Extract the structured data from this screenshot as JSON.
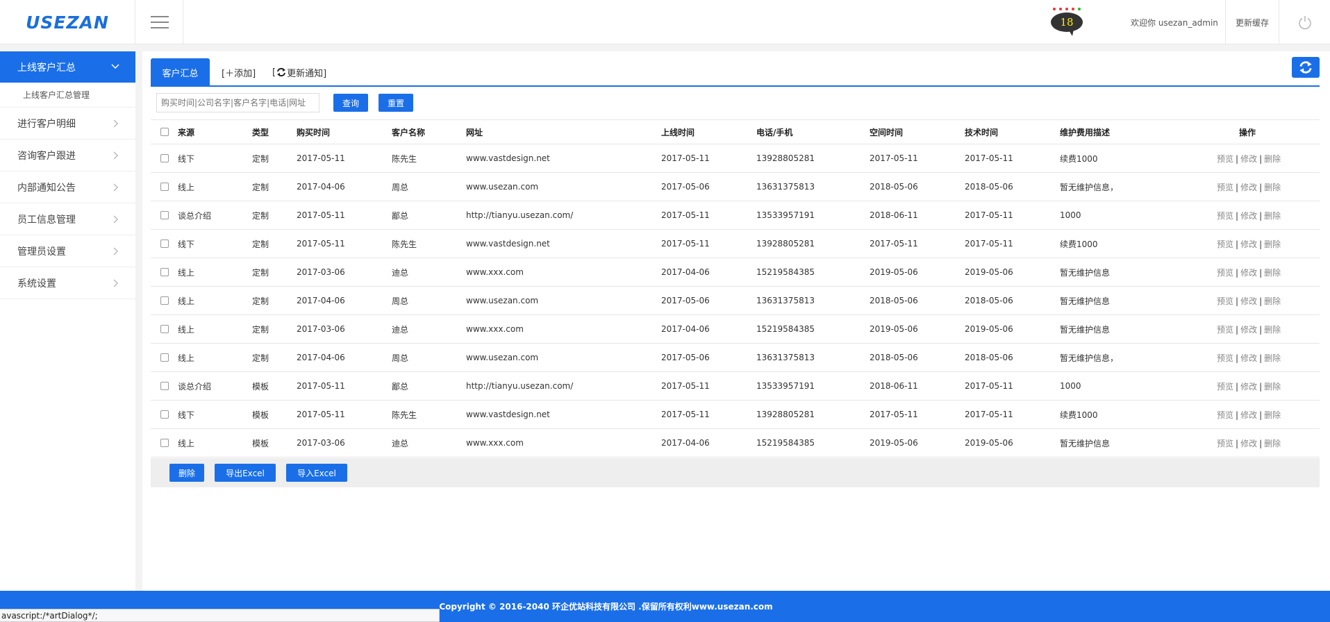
{
  "header": {
    "logo": "USEZAN",
    "notification_count": "18",
    "welcome": "欢迎你 usezan_admin",
    "refresh_cache": "更新缓存"
  },
  "sidebar": {
    "active": "上线客户汇总",
    "sub_item": "上线客户汇总管理",
    "items": [
      "进行客户明细",
      "咨询客户跟进",
      "内部通知公告",
      "员工信息管理",
      "管理员设置",
      "系统设置"
    ]
  },
  "tabs": {
    "active": "客户汇总",
    "add": "[＋添加]",
    "update_notice": "[",
    "update_notice_text": "更新通知]"
  },
  "search": {
    "placeholder": "购买时间|公司名字|客户名字|电话|网址",
    "query_button": "查询",
    "reset_button": "重置"
  },
  "table": {
    "headers": [
      "来源",
      "类型",
      "购买时间",
      "客户名称",
      "网址",
      "上线时间",
      "电话/手机",
      "空间时间",
      "技术时间",
      "维护费用描述",
      "操作"
    ],
    "rows": [
      [
        "线下",
        "定制",
        "2017-05-11",
        "陈先生",
        "www.vastdesign.net",
        "2017-05-11",
        "13928805281",
        "2017-05-11",
        "2017-05-11",
        "续费1000"
      ],
      [
        "线上",
        "定制",
        "2017-04-06",
        "周总",
        "www.usezan.com",
        "2017-05-06",
        "13631375813",
        "2018-05-06",
        "2018-05-06",
        "暂无维护信息，"
      ],
      [
        "谈总介绍",
        "定制",
        "2017-05-11",
        "鄙总",
        "http://tianyu.usezan.com/",
        "2017-05-11",
        "13533957191",
        "2018-06-11",
        "2017-05-11",
        "1000"
      ],
      [
        "线下",
        "定制",
        "2017-05-11",
        "陈先生",
        "www.vastdesign.net",
        "2017-05-11",
        "13928805281",
        "2017-05-11",
        "2017-05-11",
        "续费1000"
      ],
      [
        "线上",
        "定制",
        "2017-03-06",
        "迪总",
        "www.xxx.com",
        "2017-04-06",
        "15219584385",
        "2019-05-06",
        "2019-05-06",
        "暂无维护信息"
      ],
      [
        "线上",
        "定制",
        "2017-04-06",
        "周总",
        "www.usezan.com",
        "2017-05-06",
        "13631375813",
        "2018-05-06",
        "2018-05-06",
        "暂无维护信息"
      ],
      [
        "线上",
        "定制",
        "2017-03-06",
        "迪总",
        "www.xxx.com",
        "2017-04-06",
        "15219584385",
        "2019-05-06",
        "2019-05-06",
        "暂无维护信息"
      ],
      [
        "线上",
        "定制",
        "2017-04-06",
        "周总",
        "www.usezan.com",
        "2017-05-06",
        "13631375813",
        "2018-05-06",
        "2018-05-06",
        "暂无维护信息，"
      ],
      [
        "谈总介绍",
        "模板",
        "2017-05-11",
        "鄙总",
        "http://tianyu.usezan.com/",
        "2017-05-11",
        "13533957191",
        "2018-06-11",
        "2017-05-11",
        "1000"
      ],
      [
        "线下",
        "模板",
        "2017-05-11",
        "陈先生",
        "www.vastdesign.net",
        "2017-05-11",
        "13928805281",
        "2017-05-11",
        "2017-05-11",
        "续费1000"
      ],
      [
        "线上",
        "模板",
        "2017-03-06",
        "迪总",
        "www.xxx.com",
        "2017-04-06",
        "15219584385",
        "2019-05-06",
        "2019-05-06",
        "暂无维护信息"
      ]
    ],
    "ops": {
      "preview": "预览",
      "edit": "修改",
      "delete": "删除",
      "separator": "|"
    }
  },
  "bulk_actions": {
    "delete": "删除",
    "export": "导出Excel",
    "import": "导入Excel"
  },
  "footer": {
    "copyright": "Copyright © 2016-2040 环企优站科技有限公司 .保留所有权利www.usezan.com"
  },
  "statusbar": {
    "text": "avascript:/*artDialog*/;"
  },
  "colors": {
    "accent": "#1a6fe8",
    "logo": "#1a6fdc"
  }
}
